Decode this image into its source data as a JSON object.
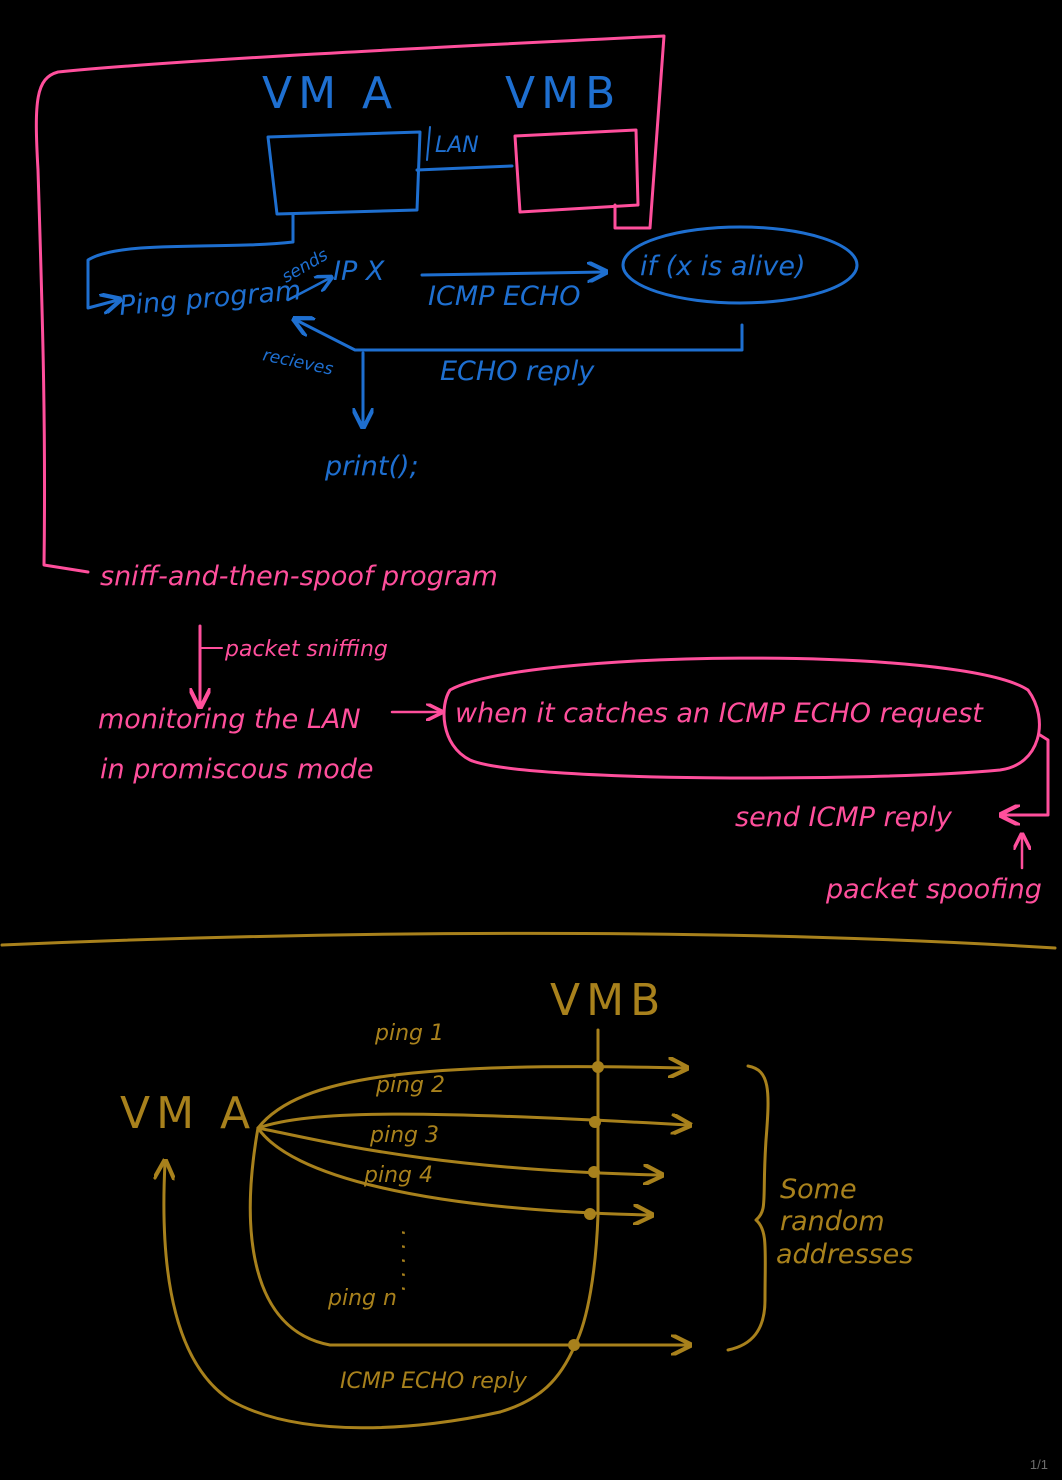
{
  "colors": {
    "background": "#000000",
    "pink": "#ff4f9c",
    "blue": "#1e6fd0",
    "gold": "#a8811c",
    "page_indicator": "#6d6d6d"
  },
  "top": {
    "vm_a_label": "VM A",
    "vm_b_label": "VMB",
    "lan_label": "LAN",
    "ping_program": "Ping program",
    "sends_label": "sends",
    "ip_x_label": "IP X",
    "icmp_echo_label": "ICMP ECHO",
    "if_alive_label": "if (x is alive)",
    "receives_label": "recieves",
    "echo_reply_label": "ECHO  reply",
    "print_label": "print();",
    "sniff_program": "sniff-and-then-spoof  program",
    "packet_sniffing": "packet sniffing",
    "monitoring_line1": "monitoring  the LAN",
    "monitoring_line2": "in  promiscous mode",
    "catches_label": "when it catches  an  ICMP  ECHO  request",
    "send_reply_label": "send ICMP reply",
    "packet_spoofing": "packet spoofing"
  },
  "bottom": {
    "vm_b_label": "VMB",
    "vm_a_label": "VM A",
    "pings": [
      "ping 1",
      "ping 2",
      "ping 3",
      "ping 4"
    ],
    "ellipsis": ". . . . .",
    "ping_n": "ping n",
    "reply_label": "ICMP ECHO reply",
    "random_line1": "Some",
    "random_line2": "random",
    "random_line3": "addresses"
  },
  "page_indicator": "1/1"
}
